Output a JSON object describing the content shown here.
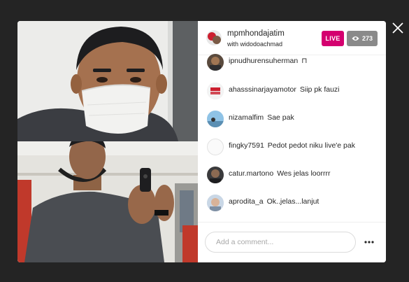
{
  "live": {
    "host_username": "mpmhondajatim",
    "guest_line": "with widodoachmad",
    "live_label": "LIVE",
    "viewer_count": "273"
  },
  "icons": {
    "close": "close-icon",
    "viewers": "eye-icon",
    "more": "more-options-icon"
  },
  "comments": [
    {
      "username": "ipnudhurensuherman",
      "message": "",
      "tail": "⊓",
      "avatar": "dark-photo"
    },
    {
      "username": "ahasssinarjayamotor",
      "message": "Siip pk fauzi",
      "avatar": "honda-logo"
    },
    {
      "username": "nizamalfim",
      "message": "Sae pak",
      "avatar": "sky-photo"
    },
    {
      "username": "fingky7591",
      "message": "Pedot pedot niku live'e pak",
      "avatar": "blank"
    },
    {
      "username": "catur.martono",
      "message": "Wes jelas loorrrr",
      "avatar": "portrait"
    },
    {
      "username": "aprodita_a",
      "message": "Ok..jelas...lanjut",
      "avatar": "selfie"
    }
  ],
  "composer": {
    "placeholder": "Add a comment..."
  },
  "colors": {
    "live_badge": "#d4006f",
    "viewer_badge": "#8a8a8a",
    "backdrop": "#242424"
  }
}
